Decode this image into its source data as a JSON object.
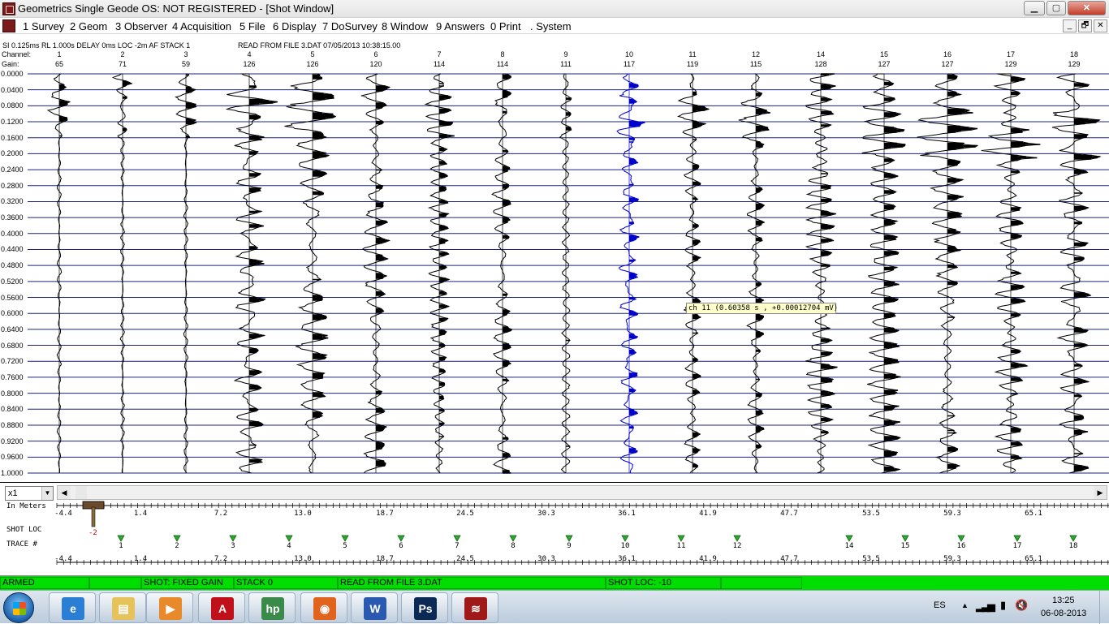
{
  "window": {
    "title": "Geometrics Single Geode OS: NOT REGISTERED - [Shot Window]",
    "controls": {
      "minimize": "▁",
      "maximize": "▢",
      "close": "✕"
    },
    "mdi_controls": {
      "minimize": "_",
      "restore": "🗗",
      "close": "✕"
    }
  },
  "menu": [
    "1 Survey",
    "2 Geom",
    "3 Observer",
    "4 Acquisition",
    "5 File",
    "6 Display",
    "7 DoSurvey",
    "8 Window",
    "9 Answers",
    "0 Print",
    ". System"
  ],
  "header": {
    "params": "SI 0.125ms   RL 1.000s   DELAY 0ms   LOC -2m  AF   STACK 1",
    "file_info": "READ FROM FILE 3.DAT 07/05/2013 10:38:15.00",
    "channel_label": "Channel:",
    "gain_label": "Gain:"
  },
  "channels": [
    {
      "ch": "1",
      "gain": "65"
    },
    {
      "ch": "2",
      "gain": "71"
    },
    {
      "ch": "3",
      "gain": "59"
    },
    {
      "ch": "4",
      "gain": "126"
    },
    {
      "ch": "5",
      "gain": "126"
    },
    {
      "ch": "6",
      "gain": "120"
    },
    {
      "ch": "7",
      "gain": "114"
    },
    {
      "ch": "8",
      "gain": "114"
    },
    {
      "ch": "9",
      "gain": "111"
    },
    {
      "ch": "10",
      "gain": "117"
    },
    {
      "ch": "11",
      "gain": "119"
    },
    {
      "ch": "12",
      "gain": "115"
    },
    {
      "ch": "14",
      "gain": "128"
    },
    {
      "ch": "15",
      "gain": "127"
    },
    {
      "ch": "16",
      "gain": "127"
    },
    {
      "ch": "17",
      "gain": "129"
    },
    {
      "ch": "18",
      "gain": "129"
    }
  ],
  "time_labels": [
    "0.0000",
    "0.0400",
    "0.0800",
    "0.1200",
    "0.1600",
    "0.2000",
    "0.2400",
    "0.2800",
    "0.3200",
    "0.3600",
    "0.4000",
    "0.4400",
    "0.4800",
    "0.5200",
    "0.5600",
    "0.6000",
    "0.6400",
    "0.6800",
    "0.7200",
    "0.7600",
    "0.8000",
    "0.8400",
    "0.8800",
    "0.9200",
    "0.9600",
    "1.0000"
  ],
  "selected_channel": "10",
  "colors": {
    "trace": "#000000",
    "selected_trace": "#0000cc",
    "time_line": "#1a237e",
    "status_bg": "#00dd00",
    "tooltip_bg": "#ffffcc"
  },
  "tooltip": "ch   11 (0.60358 s , +0.00012704 mV)",
  "geometry": {
    "zoom": "x1",
    "in_meters_label": "In Meters",
    "shot_loc_label": "SHOT LOC",
    "trace_label": "TRACE #",
    "scale_labels": [
      "-4.4",
      "1.4",
      "7.2",
      "13.0",
      "18.7",
      "24.5",
      "30.3",
      "36.1",
      "41.9",
      "47.7",
      "53.5",
      "59.3",
      "65.1"
    ],
    "shot_value": "-2",
    "trace_markers": [
      "1",
      "2",
      "3",
      "4",
      "5",
      "6",
      "7",
      "8",
      "9",
      "10",
      "11",
      "12",
      "14",
      "15",
      "16",
      "17",
      "18"
    ]
  },
  "status": {
    "armed": "ARMED",
    "gain": "SHOT: FIXED GAIN",
    "stack": "STACK 0",
    "file": "READ FROM FILE 3.DAT",
    "shot_loc": "SHOT LOC: -10"
  },
  "taskbar": {
    "apps": [
      {
        "name": "internet-explorer",
        "color": "#2a7fd4",
        "glyph": "e"
      },
      {
        "name": "file-explorer",
        "color": "#e6c35a",
        "glyph": "▤"
      },
      {
        "name": "media-player",
        "color": "#e98a2a",
        "glyph": "▶"
      },
      {
        "name": "adobe-reader",
        "color": "#c0101a",
        "glyph": "A"
      },
      {
        "name": "hp-solution-center",
        "color": "#3a8a4a",
        "glyph": "hp"
      },
      {
        "name": "firefox",
        "color": "#e2641c",
        "glyph": "◉"
      },
      {
        "name": "word",
        "color": "#2a5ab0",
        "glyph": "W"
      },
      {
        "name": "photoshop",
        "color": "#0a2a55",
        "glyph": "Ps"
      },
      {
        "name": "geode-seismograph",
        "color": "#a01818",
        "glyph": "≋"
      }
    ],
    "lang": "ES",
    "time": "13:25",
    "date": "06-08-2013"
  }
}
